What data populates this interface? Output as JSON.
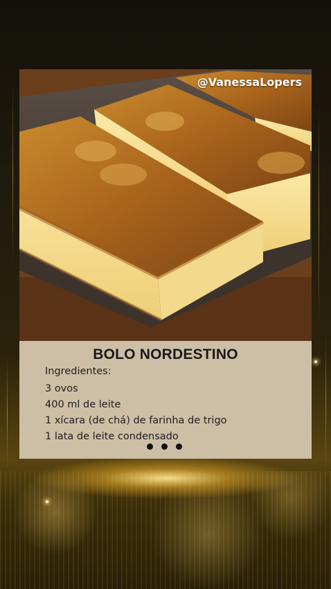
{
  "post": {
    "watermark": "@VanessaLopers",
    "photo_subject": "bolo nordestino slices in baking pan",
    "title": "BOLO NORDESTINO",
    "ingredients_label": "Ingredientes:",
    "ingredients": [
      "3 ovos",
      "400 ml de leite",
      "1 xícara (de chá) de farinha de trigo",
      "1 lata de leite condensado"
    ],
    "carousel_dots": 3
  },
  "colors": {
    "panel_bg": "#cdbfa6",
    "title_text": "#1a1a1a",
    "background_gold": "#e6aa28"
  },
  "icons": {
    "more": "more-dots-icon"
  }
}
